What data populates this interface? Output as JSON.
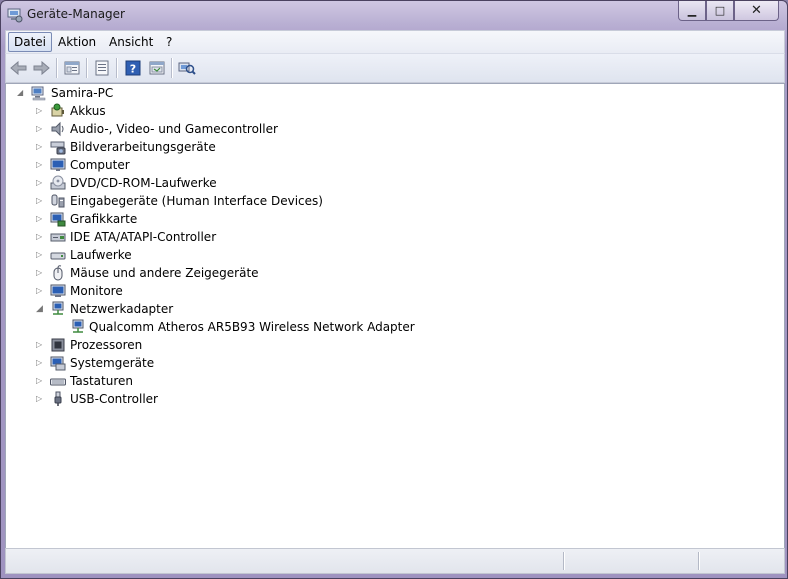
{
  "window": {
    "title": "Geräte-Manager"
  },
  "caption": {
    "minimize": "▁",
    "maximize": "□",
    "close": "✕"
  },
  "menu": [
    {
      "label": "Datei",
      "active": true
    },
    {
      "label": "Aktion"
    },
    {
      "label": "Ansicht"
    },
    {
      "label": "?"
    }
  ],
  "toolbar": {
    "buttons": [
      {
        "name": "back-icon"
      },
      {
        "name": "forward-icon"
      },
      {
        "name": "show-hide-tree-icon"
      },
      {
        "name": "properties-icon"
      },
      {
        "name": "help-icon"
      },
      {
        "name": "action-view-icon"
      },
      {
        "name": "scan-hardware-icon"
      }
    ]
  },
  "tree": {
    "root": {
      "label": "Samira-PC",
      "expanded": true,
      "icon": "computer-icon"
    },
    "items": [
      {
        "label": "Akkus",
        "icon": "battery-icon"
      },
      {
        "label": "Audio-, Video- und Gamecontroller",
        "icon": "speaker-icon"
      },
      {
        "label": "Bildverarbeitungsgeräte",
        "icon": "scanner-camera-icon"
      },
      {
        "label": "Computer",
        "icon": "monitor-icon"
      },
      {
        "label": "DVD/CD-ROM-Laufwerke",
        "icon": "optical-drive-icon"
      },
      {
        "label": "Eingabegeräte (Human Interface Devices)",
        "icon": "hid-icon"
      },
      {
        "label": "Grafikkarte",
        "icon": "display-adapter-icon"
      },
      {
        "label": "IDE ATA/ATAPI-Controller",
        "icon": "ide-controller-icon"
      },
      {
        "label": "Laufwerke",
        "icon": "disk-drive-icon"
      },
      {
        "label": "Mäuse und andere Zeigegeräte",
        "icon": "mouse-icon"
      },
      {
        "label": "Monitore",
        "icon": "monitor-icon"
      },
      {
        "label": "Netzwerkadapter",
        "icon": "network-adapter-icon",
        "expanded": true,
        "children": [
          {
            "label": "Qualcomm Atheros AR5B93 Wireless Network Adapter",
            "icon": "network-adapter-icon"
          }
        ]
      },
      {
        "label": "Prozessoren",
        "icon": "processor-icon"
      },
      {
        "label": "Systemgeräte",
        "icon": "system-device-icon"
      },
      {
        "label": "Tastaturen",
        "icon": "keyboard-icon"
      },
      {
        "label": "USB-Controller",
        "icon": "usb-icon"
      }
    ]
  },
  "status": {
    "sections": 3
  },
  "colors": {
    "title_bar": "#a79cc6",
    "pane": "#ffffff",
    "chrome": "#e2e5ec"
  }
}
